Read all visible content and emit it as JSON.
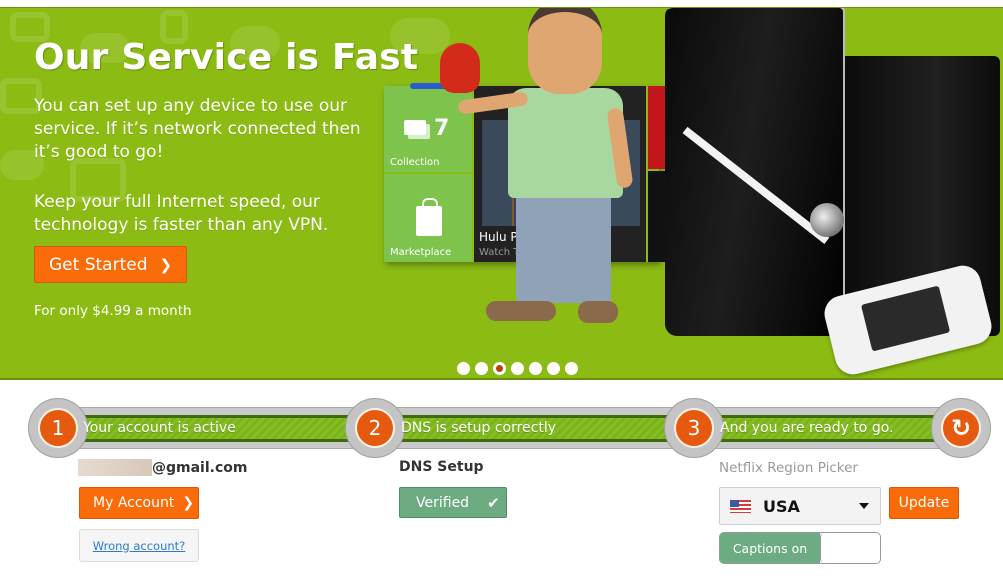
{
  "hero": {
    "title": "Our Service is Fast",
    "paragraph1": "You can set up any device to use our service. If it’s network connected then it’s good to go!",
    "paragraph2": "Keep your full Internet speed, our technology is faster than any VPN.",
    "cta_label": "Get Started",
    "cta_icon": "chevron-right-icon",
    "price_note": "For only $4.99 a month",
    "image": {
      "tiles": {
        "collection_count": "7",
        "collection_label": "Collection",
        "marketplace_label": "Marketplace",
        "hulu_title": "Hulu P",
        "hulu_sub": "Watch T"
      }
    },
    "carousel": {
      "total": 7,
      "active_index": 2
    }
  },
  "steps": [
    {
      "number": "1",
      "label": "Your account is active"
    },
    {
      "number": "2",
      "label": "DNS is setup correctly"
    },
    {
      "number": "3",
      "label": "And you are ready to go."
    }
  ],
  "steps_action_icon": "refresh-icon",
  "account": {
    "email_domain": "@gmail.com",
    "my_account_label": "My Account",
    "wrong_account_label": "Wrong account?"
  },
  "dns": {
    "title": "DNS Setup",
    "status_label": "Verified",
    "status_icon": "checkmark-icon"
  },
  "region": {
    "title": "Netflix Region Picker",
    "selected": "USA",
    "flag_icon": "us-flag-icon",
    "update_label": "Update",
    "captions_label": "Captions on"
  },
  "colors": {
    "hero_green": "#8cbb14",
    "accent_orange": "#fa6b0a",
    "verified_green": "#6dac82",
    "link_blue": "#2a7bd0"
  }
}
